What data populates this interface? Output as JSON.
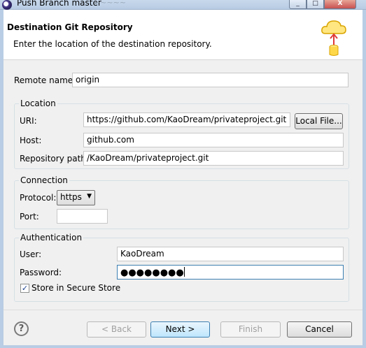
{
  "window": {
    "title": "Push Branch master",
    "ghost_text": "~~~~~",
    "buttons": {
      "minimize": "_",
      "maximize": "□",
      "close": "X"
    }
  },
  "header": {
    "title": "Destination Git Repository",
    "description": "Enter the location of the destination repository.",
    "icon": "cloud-upload-icon"
  },
  "remote": {
    "label": "Remote name:",
    "value": "origin"
  },
  "location": {
    "group_title": "Location",
    "uri_label": "URI:",
    "uri_value": "https://github.com/KaoDream/privateproject.git",
    "local_file_button": "Local File...",
    "host_label": "Host:",
    "host_value": "github.com",
    "repo_path_label": "Repository path:",
    "repo_path_value": "/KaoDream/privateproject.git"
  },
  "connection": {
    "group_title": "Connection",
    "protocol_label": "Protocol:",
    "protocol_value": "https",
    "port_label": "Port:",
    "port_value": ""
  },
  "authentication": {
    "group_title": "Authentication",
    "user_label": "User:",
    "user_value": "KaoDream",
    "password_label": "Password:",
    "password_value": "●●●●●●●●",
    "store_label": "Store in Secure Store",
    "store_checked": true
  },
  "footer": {
    "help_icon": "help-icon",
    "back_button": "< Back",
    "next_button": "Next >",
    "finish_button": "Finish",
    "cancel_button": "Cancel"
  }
}
